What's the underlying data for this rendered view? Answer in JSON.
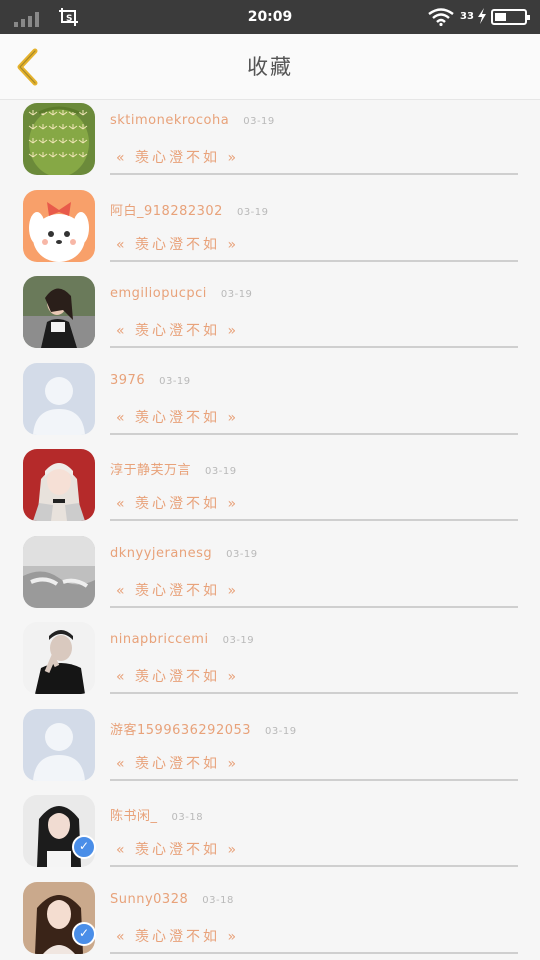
{
  "status_bar": {
    "time": "20:09",
    "battery_text": "33",
    "battery_level": 0.33
  },
  "header": {
    "title": "收藏",
    "back_icon": "chevron-left-icon",
    "accent_color": "#e5b22c"
  },
  "items": [
    {
      "name": "sktimonekrocoha",
      "date": "03-19",
      "quote": "« 羡心澄不如 »",
      "avatar": "cactus",
      "verified": false
    },
    {
      "name": "阿白_918282302",
      "date": "03-19",
      "quote": "« 羡心澄不如 »",
      "avatar": "cartoon-dog",
      "verified": false
    },
    {
      "name": "emgiliopucpci",
      "date": "03-19",
      "quote": "« 羡心澄不如 »",
      "avatar": "photo-woman",
      "verified": false
    },
    {
      "name": "3976",
      "date": "03-19",
      "quote": "« 羡心澄不如 »",
      "avatar": "default",
      "verified": false
    },
    {
      "name": "淳于静芙万言",
      "date": "03-19",
      "quote": "« 羡心澄不如 »",
      "avatar": "photo-anime-girl",
      "verified": false
    },
    {
      "name": "dknyyjeranesg",
      "date": "03-19",
      "quote": "« 羡心澄不如 »",
      "avatar": "photo-hands",
      "verified": false
    },
    {
      "name": "ninapbriccemi",
      "date": "03-19",
      "quote": "« 羡心澄不如 »",
      "avatar": "photo-man",
      "verified": false
    },
    {
      "name": "游客1599636292053",
      "date": "03-19",
      "quote": "« 羡心澄不如 »",
      "avatar": "default",
      "verified": false
    },
    {
      "name": "陈书闲_",
      "date": "03-18",
      "quote": "« 羡心澄不如 »",
      "avatar": "photo-woman-dark-hair",
      "verified": true
    },
    {
      "name": "Sunny0328",
      "date": "03-18",
      "quote": "« 羡心澄不如 »",
      "avatar": "photo-woman-portrait",
      "verified": true
    }
  ],
  "colors": {
    "text_accent": "#e8a27a",
    "date": "#b9b9b9",
    "status_bar_bg": "#3b3b3b",
    "verified_badge": "#4a8ee8"
  }
}
